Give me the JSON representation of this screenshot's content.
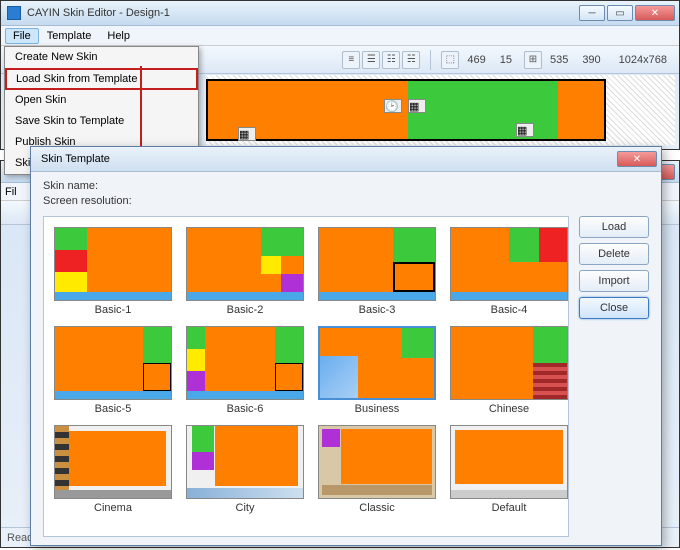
{
  "main_window": {
    "title": "CAYIN Skin Editor - Design-1",
    "menubar": {
      "file": "File",
      "template": "Template",
      "help": "Help"
    },
    "toolbar_values": {
      "w": "469",
      "h": "15",
      "x": "535",
      "y": "390",
      "resolution": "1024x768"
    },
    "file_menu": {
      "create": "Create New Skin",
      "load_template": "Load Skin from Template",
      "open": "Open Skin",
      "save_template": "Save Skin to Template",
      "publish": "Publish Skin",
      "settings": "Skin Settings"
    }
  },
  "dialog": {
    "title": "Skin Template",
    "skin_name_label": "Skin name:",
    "resolution_label": "Screen resolution:",
    "buttons": {
      "load": "Load",
      "delete": "Delete",
      "import": "Import",
      "close": "Close"
    },
    "templates": [
      {
        "label": "Basic-1"
      },
      {
        "label": "Basic-2"
      },
      {
        "label": "Basic-3"
      },
      {
        "label": "Basic-4"
      },
      {
        "label": "Basic-5"
      },
      {
        "label": "Basic-6"
      },
      {
        "label": "Business"
      },
      {
        "label": "Chinese"
      },
      {
        "label": "Cinema"
      },
      {
        "label": "City"
      },
      {
        "label": "Classic"
      },
      {
        "label": "Default"
      }
    ]
  },
  "bg_window": {
    "file": "Fil",
    "status": "Read"
  }
}
